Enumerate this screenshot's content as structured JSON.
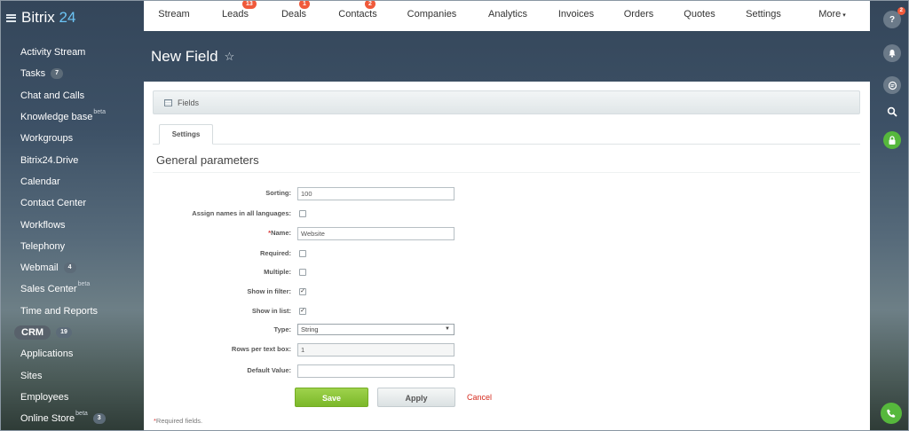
{
  "app": {
    "brand_name": "Bitrix",
    "brand_suffix": "24"
  },
  "sidebar": {
    "items": [
      {
        "label": "Activity Stream"
      },
      {
        "label": "Tasks",
        "count": "7"
      },
      {
        "label": "Chat and Calls"
      },
      {
        "label": "Knowledge base",
        "sup": "beta"
      },
      {
        "label": "Workgroups"
      },
      {
        "label": "Bitrix24.Drive"
      },
      {
        "label": "Calendar"
      },
      {
        "label": "Contact Center"
      },
      {
        "label": "Workflows"
      },
      {
        "label": "Telephony"
      },
      {
        "label": "Webmail",
        "count": "4"
      },
      {
        "label": "Sales Center",
        "sup": "beta"
      },
      {
        "label": "Time and Reports"
      },
      {
        "label": "CRM",
        "count": "19",
        "active": true
      },
      {
        "label": "Applications"
      },
      {
        "label": "Sites"
      },
      {
        "label": "Employees"
      },
      {
        "label": "Online Store",
        "sup": "beta",
        "count": "3"
      }
    ]
  },
  "topnav": {
    "items": [
      {
        "label": "Stream"
      },
      {
        "label": "Leads",
        "badge": "13"
      },
      {
        "label": "Deals",
        "badge": "1"
      },
      {
        "label": "Contacts",
        "badge": "2"
      },
      {
        "label": "Companies"
      },
      {
        "label": "Analytics"
      },
      {
        "label": "Invoices"
      },
      {
        "label": "Orders"
      },
      {
        "label": "Quotes"
      },
      {
        "label": "Settings"
      },
      {
        "label": "More"
      }
    ]
  },
  "rail": {
    "help_badge": "2",
    "help_glyph": "?"
  },
  "page": {
    "title": "New Field"
  },
  "form": {
    "section_label": "Fields",
    "tab_label": "Settings",
    "heading": "General parameters",
    "fields": {
      "sorting": {
        "label": "Sorting:",
        "value": "100"
      },
      "assign_names": {
        "label": "Assign names in all languages:",
        "checked": false
      },
      "name": {
        "label": "Name:",
        "required_mark": "*",
        "value": "Website"
      },
      "required": {
        "label": "Required:",
        "checked": false
      },
      "multiple": {
        "label": "Multiple:",
        "checked": false
      },
      "show_in_filter": {
        "label": "Show in filter:",
        "checked": true
      },
      "show_in_list": {
        "label": "Show in list:",
        "checked": true
      },
      "type": {
        "label": "Type:",
        "value": "String"
      },
      "rows": {
        "label": "Rows per text box:",
        "value": "1"
      },
      "default_value": {
        "label": "Default Value:",
        "value": ""
      }
    },
    "buttons": {
      "save": "Save",
      "apply": "Apply",
      "cancel": "Cancel"
    },
    "required_note": {
      "mark": "*",
      "text": "Required fields."
    }
  },
  "colors": {
    "accent": "#2fc6f6",
    "save_green": "#8cc63e",
    "badge_red": "#f05a3b",
    "cancel_red": "#d52a1d"
  }
}
